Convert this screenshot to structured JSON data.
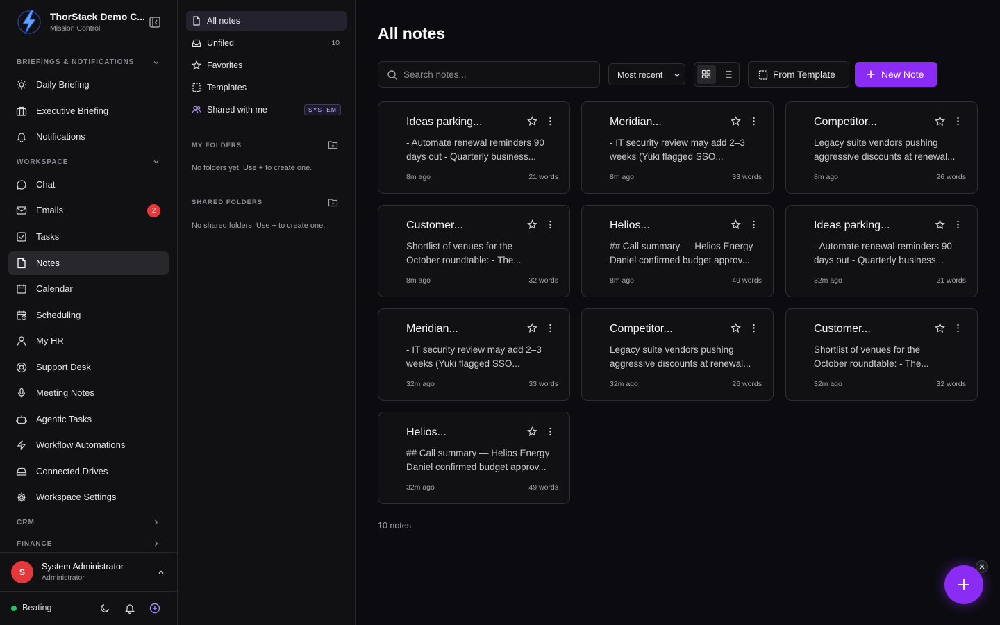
{
  "brand": {
    "title": "ThorStack Demo C...",
    "subtitle": "Mission Control"
  },
  "sidebar": {
    "section_briefings": "BRIEFINGS & NOTIFICATIONS",
    "section_workspace": "WORKSPACE",
    "section_crm": "CRM",
    "section_finance": "FINANCE",
    "items": [
      {
        "label": "Daily Briefing",
        "icon": "sun-icon"
      },
      {
        "label": "Executive Briefing",
        "icon": "briefcase-icon"
      },
      {
        "label": "Notifications",
        "icon": "bell-icon"
      },
      {
        "label": "Chat",
        "icon": "chat-icon"
      },
      {
        "label": "Emails",
        "icon": "mail-icon",
        "badge": "2"
      },
      {
        "label": "Tasks",
        "icon": "checkbox-icon"
      },
      {
        "label": "Notes",
        "icon": "note-icon",
        "active": true
      },
      {
        "label": "Calendar",
        "icon": "calendar-icon"
      },
      {
        "label": "Scheduling",
        "icon": "calendar-clock-icon"
      },
      {
        "label": "My HR",
        "icon": "user-icon"
      },
      {
        "label": "Support Desk",
        "icon": "lifebuoy-icon"
      },
      {
        "label": "Meeting Notes",
        "icon": "mic-icon"
      },
      {
        "label": "Agentic Tasks",
        "icon": "bot-icon"
      },
      {
        "label": "Workflow Automations",
        "icon": "bolt-icon"
      },
      {
        "label": "Connected Drives",
        "icon": "drive-icon"
      },
      {
        "label": "Workspace Settings",
        "icon": "gear-icon"
      }
    ]
  },
  "user": {
    "initial": "S",
    "name": "System Administrator",
    "role": "Administrator"
  },
  "status": {
    "label": "Beating",
    "color": "#22c55e"
  },
  "notes_nav": {
    "items": [
      {
        "label": "All notes",
        "icon": "file-icon",
        "active": true
      },
      {
        "label": "Unfiled",
        "icon": "inbox-icon",
        "count": "10"
      },
      {
        "label": "Favorites",
        "icon": "star-icon"
      },
      {
        "label": "Templates",
        "icon": "template-icon"
      },
      {
        "label": "Shared with me",
        "icon": "users-icon",
        "tag": "SYSTEM"
      }
    ],
    "my_folders": {
      "label": "MY FOLDERS",
      "empty": "No folders yet. Use + to create one."
    },
    "shared_folders": {
      "label": "SHARED FOLDERS",
      "empty": "No shared folders. Use + to create one."
    }
  },
  "main": {
    "title": "All notes",
    "search_placeholder": "Search notes...",
    "sort": "Most recent",
    "from_template": "From Template",
    "new_note": "New Note",
    "notes_count": "10 notes",
    "accent": "#8b2cf5"
  },
  "notes": [
    {
      "title": "Ideas parking...",
      "line1": "- Automate renewal reminders 90",
      "line2": "days out - Quarterly business...",
      "time": "8m ago",
      "words": "21 words"
    },
    {
      "title": "Meridian...",
      "line1": "- IT security review may add 2–3",
      "line2": "weeks (Yuki flagged SSO...",
      "time": "8m ago",
      "words": "33 words"
    },
    {
      "title": "Competitor...",
      "line1": "Legacy suite vendors pushing",
      "line2": "aggressive discounts at renewal...",
      "time": "8m ago",
      "words": "26 words"
    },
    {
      "title": "Customer...",
      "line1": "Shortlist of venues for the",
      "line2": "October roundtable: - The...",
      "time": "8m ago",
      "words": "32 words"
    },
    {
      "title": "Helios...",
      "line1": "## Call summary — Helios Energy",
      "line2": "Daniel confirmed budget approv...",
      "time": "8m ago",
      "words": "49 words"
    },
    {
      "title": "Ideas parking...",
      "line1": "- Automate renewal reminders 90",
      "line2": "days out - Quarterly business...",
      "time": "32m ago",
      "words": "21 words"
    },
    {
      "title": "Meridian...",
      "line1": "- IT security review may add 2–3",
      "line2": "weeks (Yuki flagged SSO...",
      "time": "32m ago",
      "words": "33 words"
    },
    {
      "title": "Competitor...",
      "line1": "Legacy suite vendors pushing",
      "line2": "aggressive discounts at renewal...",
      "time": "32m ago",
      "words": "26 words"
    },
    {
      "title": "Customer...",
      "line1": "Shortlist of venues for the",
      "line2": "October roundtable: - The...",
      "time": "32m ago",
      "words": "32 words"
    },
    {
      "title": "Helios...",
      "line1": "## Call summary — Helios Energy",
      "line2": "Daniel confirmed budget approv...",
      "time": "32m ago",
      "words": "49 words"
    }
  ]
}
